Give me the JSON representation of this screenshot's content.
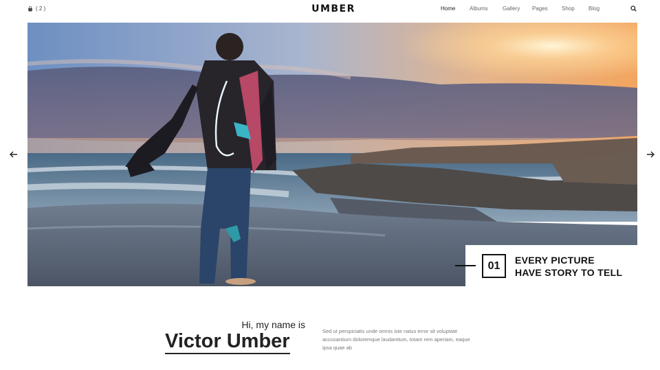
{
  "header": {
    "cart_count": "( 2 )",
    "logo": "UMBER",
    "nav": [
      "Home",
      "Albums",
      "Gallery",
      "Pages",
      "Shop",
      "Blog"
    ]
  },
  "slider": {
    "number": "01",
    "caption_line1": "EVERY PICTURE",
    "caption_line2": "HAVE STORY TO TELL",
    "prev_icon": "arrow-left-icon",
    "next_icon": "arrow-right-icon"
  },
  "intro": {
    "greeting": "Hi, my name is",
    "name": "Victor Umber",
    "bio": "Sed ut perspiciatis unde omnis iste natus error sit voluptate accusantium doloremque laudantium, totam rem aperiam, eaque ipsa quae ab"
  },
  "colors": {
    "text": "#222222",
    "muted": "#777777",
    "background": "#ffffff"
  }
}
